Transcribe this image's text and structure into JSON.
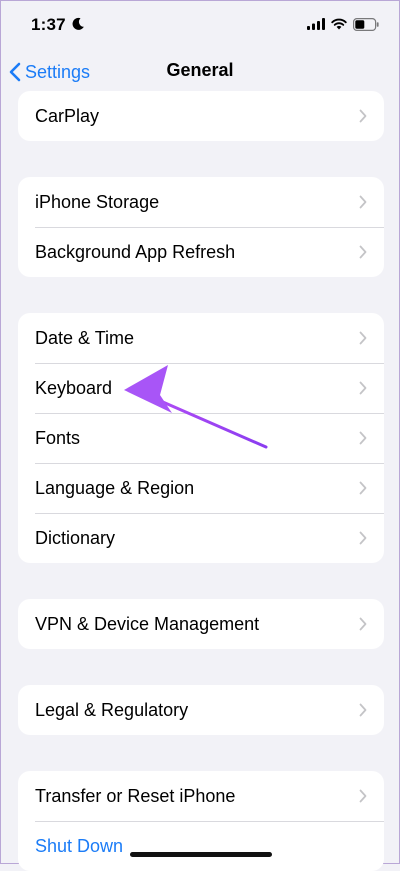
{
  "status": {
    "time": "1:37"
  },
  "nav": {
    "back_label": "Settings",
    "title": "General"
  },
  "groups": [
    {
      "items": [
        {
          "label": "CarPlay"
        }
      ]
    },
    {
      "items": [
        {
          "label": "iPhone Storage"
        },
        {
          "label": "Background App Refresh"
        }
      ]
    },
    {
      "items": [
        {
          "label": "Date & Time"
        },
        {
          "label": "Keyboard"
        },
        {
          "label": "Fonts"
        },
        {
          "label": "Language & Region"
        },
        {
          "label": "Dictionary"
        }
      ]
    },
    {
      "items": [
        {
          "label": "VPN & Device Management"
        }
      ]
    },
    {
      "items": [
        {
          "label": "Legal & Regulatory"
        }
      ]
    },
    {
      "items": [
        {
          "label": "Transfer or Reset iPhone"
        },
        {
          "label": "Shut Down"
        }
      ]
    }
  ],
  "colors": {
    "accent": "#1b7cf7",
    "background": "#f2f2f7",
    "annotation_arrow": "#a855f7"
  }
}
